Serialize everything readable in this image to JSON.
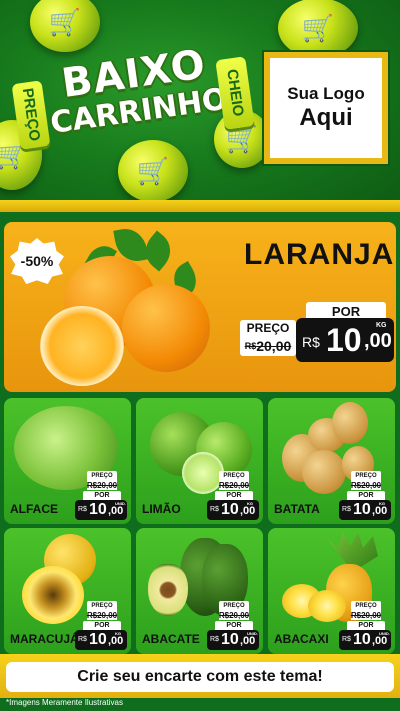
{
  "header": {
    "badge_left": "PREÇO",
    "badge_right": "CHEIO",
    "title_line1": "BAIXO",
    "title_line2": "CARRINHO",
    "logo_line1": "Sua Logo",
    "logo_line2": "Aqui",
    "cart_icon": "shopping-cart-icon",
    "accent_color": "#f6d21a",
    "brand_green": "#177a1c"
  },
  "featured": {
    "discount": "-50%",
    "name": "LARANJA",
    "old_label": "PREÇO",
    "old_price": "20,00",
    "old_prefix": "R$",
    "por_label": "POR",
    "currency": "R$",
    "price_int": "10",
    "price_dec": ",00",
    "unit": "KG"
  },
  "products": [
    {
      "name": "ALFACE",
      "old_label": "PREÇO",
      "old_price": "R$20,00",
      "por_label": "POR",
      "currency": "R$",
      "price_int": "10",
      "price_dec": ",00",
      "unit": "UNID."
    },
    {
      "name": "LIMÃO",
      "old_label": "PREÇO",
      "old_price": "R$20,00",
      "por_label": "POR",
      "currency": "R$",
      "price_int": "10",
      "price_dec": ",00",
      "unit": "KG"
    },
    {
      "name": "BATATA",
      "old_label": "PREÇO",
      "old_price": "R$20,00",
      "por_label": "POR",
      "currency": "R$",
      "price_int": "10",
      "price_dec": ",00",
      "unit": "KG"
    },
    {
      "name": "MARACUJÁ",
      "old_label": "PREÇO",
      "old_price": "R$20,00",
      "por_label": "POR",
      "currency": "R$",
      "price_int": "10",
      "price_dec": ",00",
      "unit": "KG"
    },
    {
      "name": "ABACATE",
      "old_label": "PREÇO",
      "old_price": "R$20,00",
      "por_label": "POR",
      "currency": "R$",
      "price_int": "10",
      "price_dec": ",00",
      "unit": "UNID."
    },
    {
      "name": "ABACAXI",
      "old_label": "PREÇO",
      "old_price": "R$20,00",
      "por_label": "POR",
      "currency": "R$",
      "price_int": "10",
      "price_dec": ",00",
      "unit": "UNID."
    }
  ],
  "footer": {
    "cta": "Crie seu encarte com este tema!",
    "disclaimer": "*Imagens Meramente Ilustrativas"
  }
}
